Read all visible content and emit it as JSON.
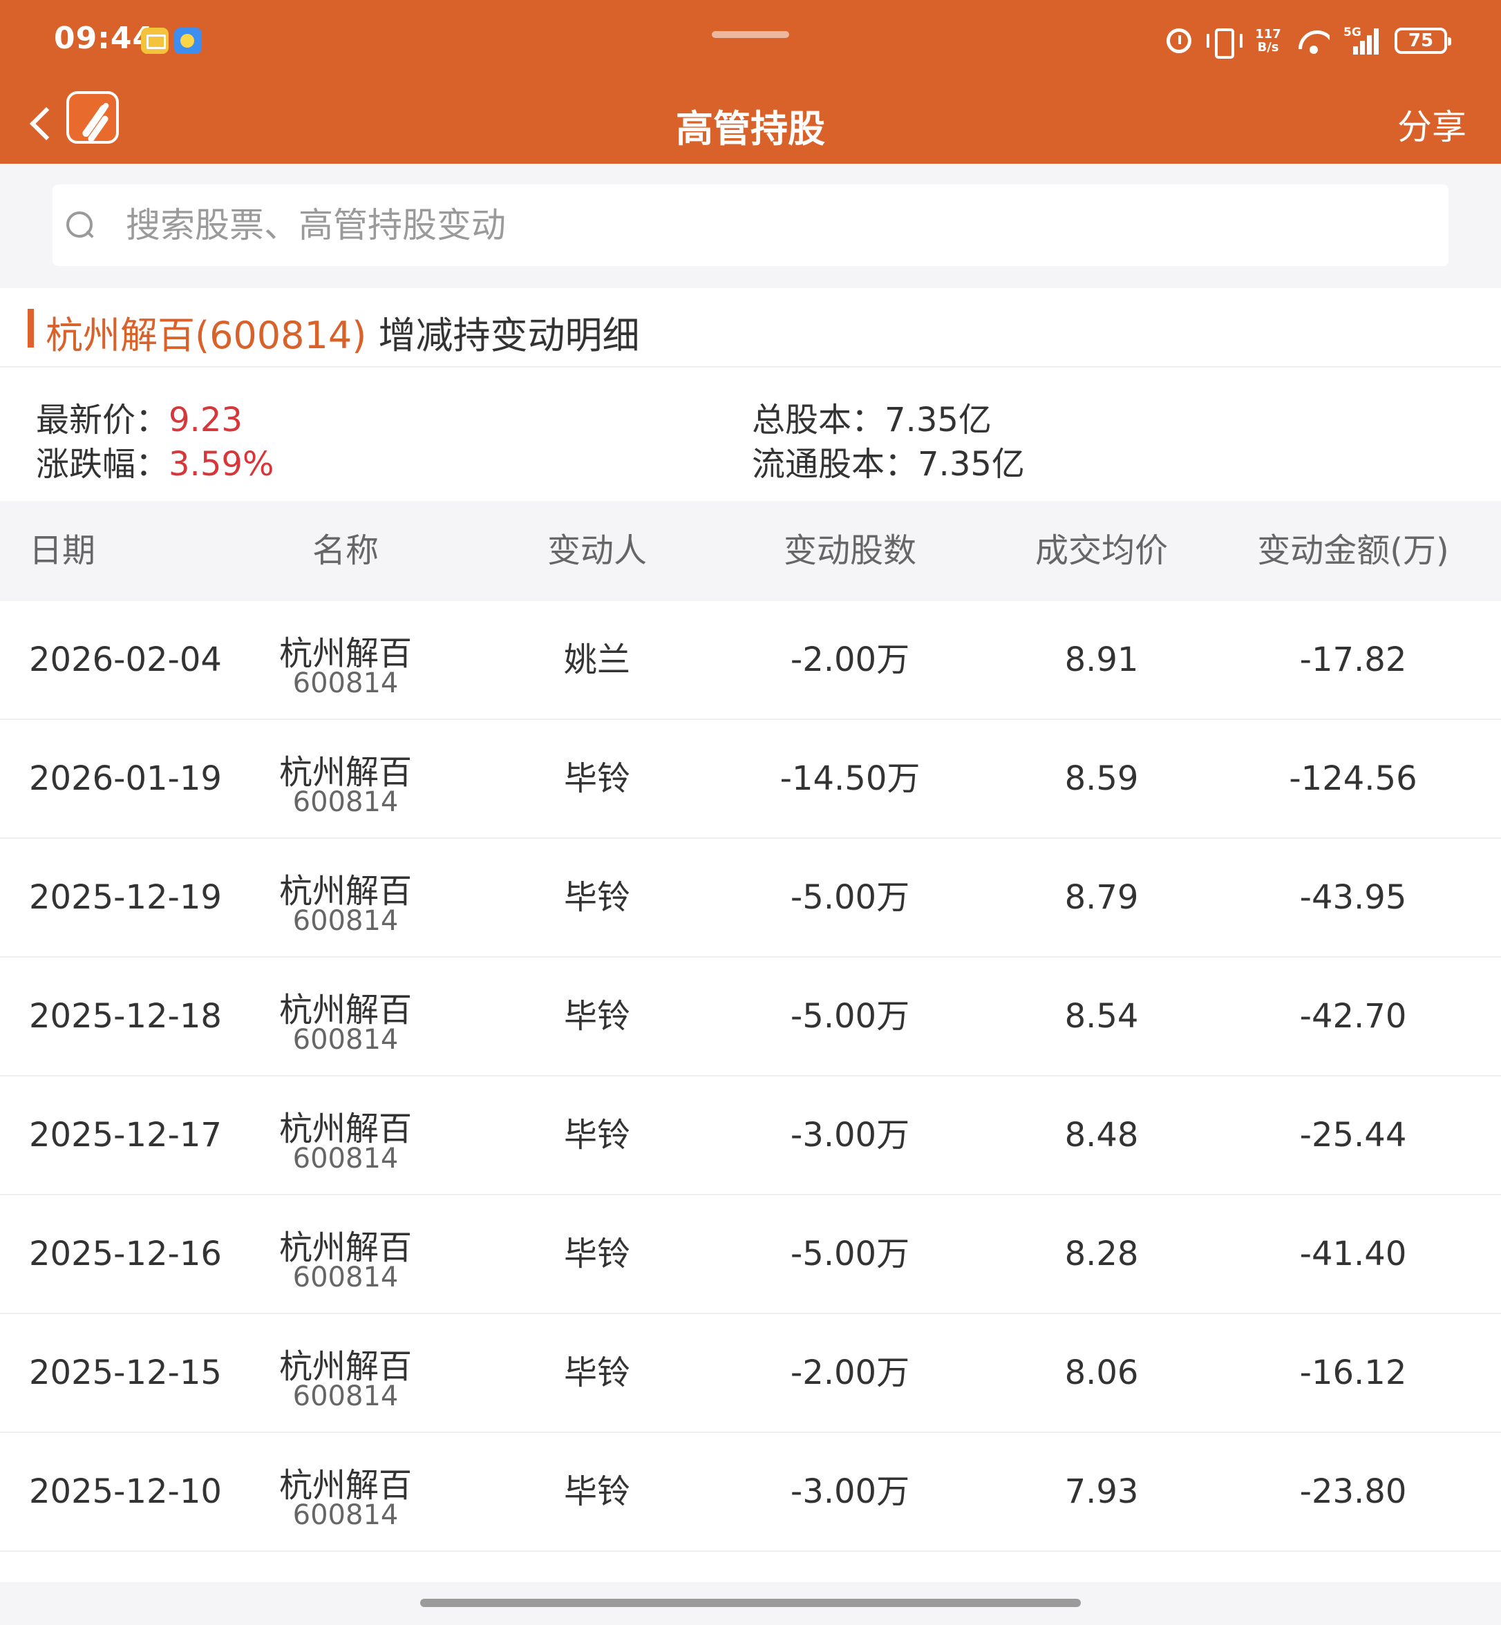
{
  "status_bar": {
    "time": "09:44",
    "net_speed_top": "117",
    "net_speed_bottom": "B/s",
    "signal_label": "5G",
    "battery": "75"
  },
  "nav": {
    "title": "高管持股",
    "share_label": "分享"
  },
  "search": {
    "placeholder": "搜索股票、高管持股变动",
    "value": ""
  },
  "section": {
    "stock_label": "杭州解百(600814)",
    "detail_label": " 增减持变动明细"
  },
  "summary": {
    "latest_price_label": "最新价：",
    "latest_price": "9.23",
    "change_label": "涨跌幅：",
    "change_pct": "3.59%",
    "total_shares_label": "总股本：",
    "total_shares": "7.35亿",
    "float_shares_label": "流通股本：",
    "float_shares": "7.35亿"
  },
  "table": {
    "columns": [
      "日期",
      "名称",
      "变动人",
      "变动股数",
      "成交均价",
      "变动金额(万)"
    ],
    "rows": [
      {
        "date": "2026-02-04",
        "name": "杭州解百",
        "code": "600814",
        "person": "姚兰",
        "shares": "-2.00万",
        "avg_price": "8.91",
        "amount": "-17.82"
      },
      {
        "date": "2026-01-19",
        "name": "杭州解百",
        "code": "600814",
        "person": "毕铃",
        "shares": "-14.50万",
        "avg_price": "8.59",
        "amount": "-124.56"
      },
      {
        "date": "2025-12-19",
        "name": "杭州解百",
        "code": "600814",
        "person": "毕铃",
        "shares": "-5.00万",
        "avg_price": "8.79",
        "amount": "-43.95"
      },
      {
        "date": "2025-12-18",
        "name": "杭州解百",
        "code": "600814",
        "person": "毕铃",
        "shares": "-5.00万",
        "avg_price": "8.54",
        "amount": "-42.70"
      },
      {
        "date": "2025-12-17",
        "name": "杭州解百",
        "code": "600814",
        "person": "毕铃",
        "shares": "-3.00万",
        "avg_price": "8.48",
        "amount": "-25.44"
      },
      {
        "date": "2025-12-16",
        "name": "杭州解百",
        "code": "600814",
        "person": "毕铃",
        "shares": "-5.00万",
        "avg_price": "8.28",
        "amount": "-41.40"
      },
      {
        "date": "2025-12-15",
        "name": "杭州解百",
        "code": "600814",
        "person": "毕铃",
        "shares": "-2.00万",
        "avg_price": "8.06",
        "amount": "-16.12"
      },
      {
        "date": "2025-12-10",
        "name": "杭州解百",
        "code": "600814",
        "person": "毕铃",
        "shares": "-3.00万",
        "avg_price": "7.93",
        "amount": "-23.80"
      }
    ]
  },
  "colors": {
    "brand_orange": "#d9612a",
    "price_red": "#d6373a"
  },
  "icons": [
    "back-arrow-icon",
    "app-logo-icon",
    "search-icon",
    "alarm-icon",
    "vibrate-icon",
    "wifi-icon",
    "signal-icon",
    "battery-icon",
    "mail-notification-icon",
    "weather-notification-icon"
  ]
}
